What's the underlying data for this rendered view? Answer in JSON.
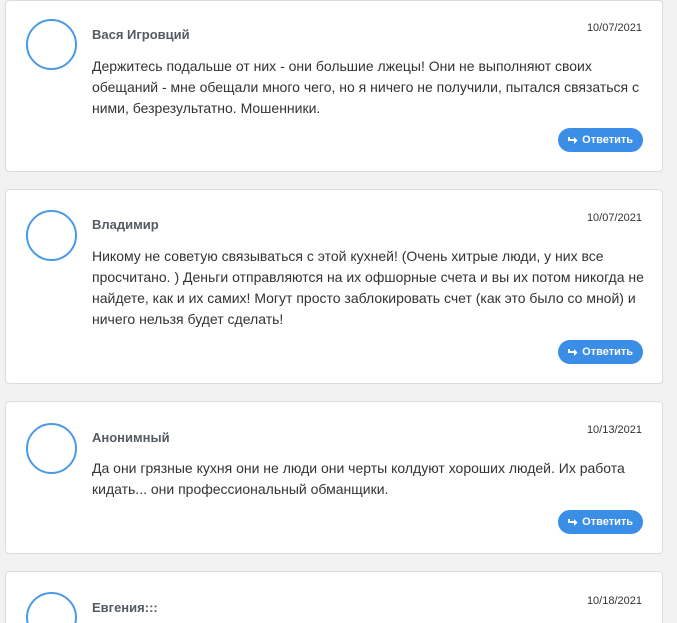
{
  "colors": {
    "accent": "#3b8ee6",
    "avatar_ring": "#4a9ae8",
    "card_bg": "#ffffff",
    "page_bg": "#f2f2f2"
  },
  "comments": [
    {
      "author": "Вася Игровций",
      "date": "10/07/2021",
      "text": "Держитесь подальше от них - они большие лжецы! Они не выполняют своих обещаний - мне обещали много чего, но я ничего не получили, пытался связаться с ними, безрезультатно. Мошенники.",
      "reply_label": "Ответить",
      "reply_icon": "reply-arrow-icon"
    },
    {
      "author": "Владимир",
      "date": "10/07/2021",
      "text": "Никому не советую связываться с этой кухней! (Очень хитрые люди, у них все просчитано. ) Деньги отправляются на их офшорные счета и вы их потом никогда не найдете, как и их самих! Могут просто заблокировать счет (как это было со мной) и ничего нельзя будет сделать!",
      "reply_label": "Ответить",
      "reply_icon": "reply-arrow-icon"
    },
    {
      "author": "Анонимный",
      "date": "10/13/2021",
      "text": "Да они грязные кухня они не люди они черты колдуют хороших людей. Их работа кидать... они профессиональный обманщики.",
      "reply_label": "Ответить",
      "reply_icon": "reply-arrow-icon"
    },
    {
      "author": "Евгения:::",
      "date": "10/18/2021"
    }
  ]
}
